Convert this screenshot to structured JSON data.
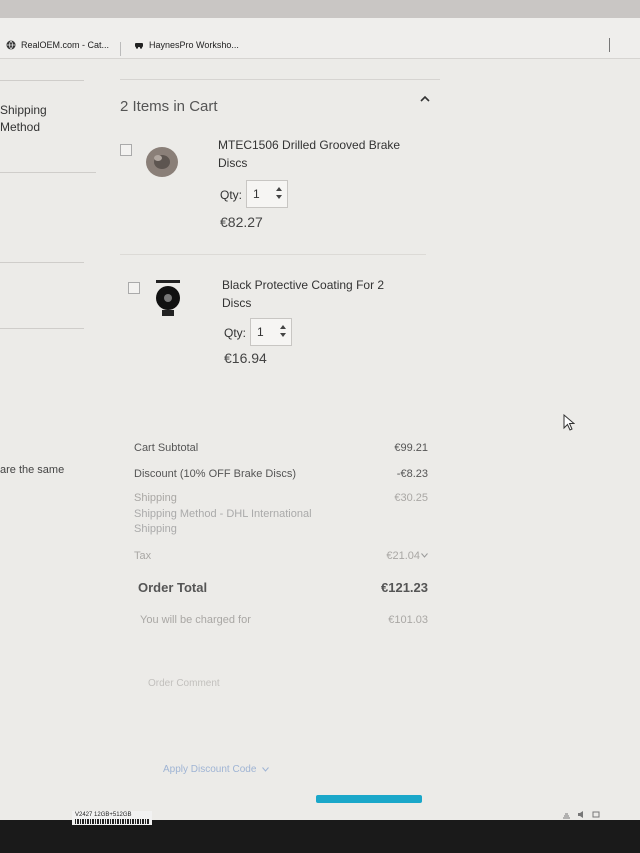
{
  "browser": {
    "bookmarks": [
      {
        "label": "RealOEM.com - Cat...",
        "icon": "globe-icon"
      },
      {
        "label": "HaynesPro Worksho...",
        "icon": "car-icon"
      }
    ]
  },
  "left_panel": {
    "shipping_label": "Shipping",
    "method_label": "Method",
    "same_note": "are the same"
  },
  "cart": {
    "title": "2 Items in Cart",
    "items": [
      {
        "name": "MTEC1506 Drilled Grooved Brake Discs",
        "qty_label": "Qty:",
        "qty": "1",
        "price": "€82.27",
        "thumb": "brake-disc-icon"
      },
      {
        "name": "Black Protective Coating For 2 Discs",
        "qty_label": "Qty:",
        "qty": "1",
        "price": "€16.94",
        "thumb": "coating-can-icon"
      }
    ]
  },
  "totals": {
    "subtotal_label": "Cart Subtotal",
    "subtotal_value": "€99.21",
    "discount_label": "Discount (10% OFF Brake Discs)",
    "discount_value": "-€8.23",
    "shipping_label": "Shipping",
    "shipping_value": "€30.25",
    "shipping_method": "Shipping Method - DHL International Shipping",
    "tax_label": "Tax",
    "tax_value": "€21.04",
    "order_total_label": "Order Total",
    "order_total_value": "€121.23",
    "charged_label": "You will be charged for",
    "charged_value": "€101.03"
  },
  "links": {
    "order_comment": "Order Comment",
    "apply_discount": "Apply Discount Code"
  },
  "device": {
    "sticker_line1": "V2427    12GB+512GB"
  },
  "colors": {
    "place_order": "#1aa7c9"
  }
}
